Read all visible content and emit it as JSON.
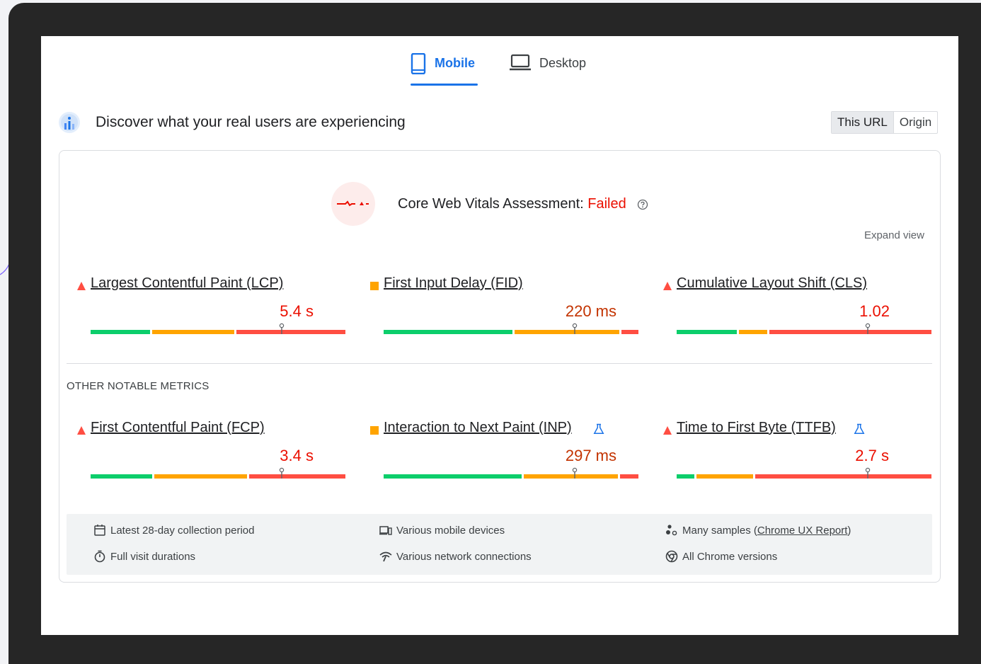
{
  "tabs": {
    "mobile": "Mobile",
    "desktop": "Desktop"
  },
  "header": {
    "title": "Discover what your real users are experiencing",
    "scope": {
      "this_url": "This URL",
      "origin": "Origin"
    }
  },
  "assessment": {
    "label": "Core Web Vitals Assessment: ",
    "status": "Failed",
    "expand": "Expand view"
  },
  "core_metrics": [
    {
      "name": "Largest Contentful Paint (LCP)",
      "value": "5.4 s",
      "status": "poor"
    },
    {
      "name": "First Input Delay (FID)",
      "value": "220 ms",
      "status": "needs-improvement"
    },
    {
      "name": "Cumulative Layout Shift (CLS)",
      "value": "1.02",
      "status": "poor"
    }
  ],
  "other_label": "OTHER NOTABLE METRICS",
  "other_metrics": [
    {
      "name": "First Contentful Paint (FCP)",
      "value": "3.4 s",
      "status": "poor"
    },
    {
      "name": "Interaction to Next Paint (INP)",
      "value": "297 ms",
      "status": "needs-improvement"
    },
    {
      "name": "Time to First Byte (TTFB)",
      "value": "2.7 s",
      "status": "poor"
    }
  ],
  "footer": {
    "period": "Latest 28-day collection period",
    "durations": "Full visit durations",
    "devices": "Various mobile devices",
    "network": "Various network connections",
    "samples_prefix": "Many samples (",
    "samples_link": "Chrome UX Report",
    "samples_suffix": ")",
    "versions": "All Chrome versions"
  },
  "colors": {
    "good": "#0cce6b",
    "average": "#ffa400",
    "poor": "#ff4e42",
    "accent": "#1a73e8",
    "fail_text": "#eb0f00",
    "avg_text": "#c33300"
  }
}
